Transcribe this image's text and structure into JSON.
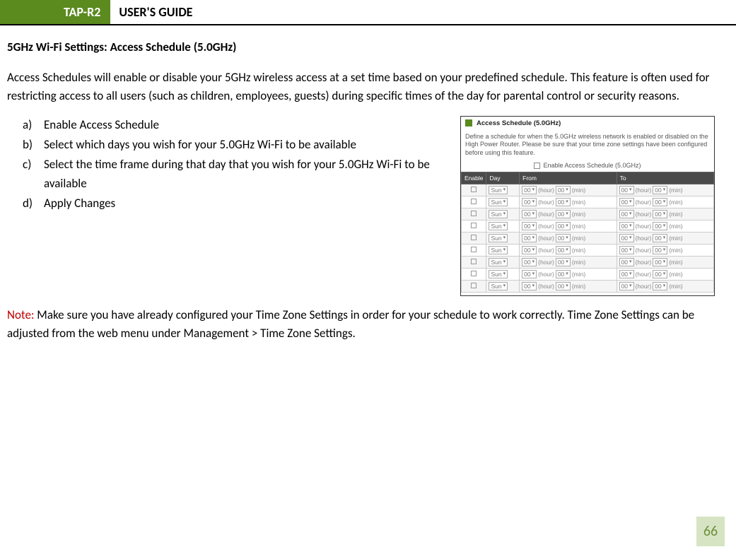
{
  "header": {
    "model": "TAP-R2",
    "title": "USER'S GUIDE"
  },
  "section_title": "5GHz Wi-Fi Settings: Access Schedule (5.0GHz)",
  "intro": "Access Schedules will enable or disable your 5GHz wireless access at a set time based on your predefined schedule. This feature is often used for restricting access to all users (such as children, employees, guests) during specific times of the day for parental control or security reasons.",
  "steps": [
    {
      "marker": "a)",
      "text": "Enable Access Schedule"
    },
    {
      "marker": "b)",
      "text": "Select which days you wish for your 5.0GHz Wi-Fi to be available"
    },
    {
      "marker": "c)",
      "text": "Select the time frame during that day that you wish for your 5.0GHz Wi-Fi to be available"
    },
    {
      "marker": "d)",
      "text": "Apply Changes"
    }
  ],
  "screenshot": {
    "title": "Access Schedule (5.0GHz)",
    "desc": "Define a schedule for when the 5.0GHz wireless network is enabled or disabled on the High Power Router. Please be sure that your time zone settings have been configured before using this feature.",
    "enable_label": "Enable Access Schedule (5.0GHz)",
    "cols": {
      "enable": "Enable",
      "day": "Day",
      "from": "From",
      "to": "To"
    },
    "row": {
      "day": "Sun",
      "hh": "00",
      "mm": "00",
      "hour_lbl": "(hour)",
      "min_lbl": "(min)"
    },
    "row_count": 9
  },
  "note": {
    "label": "Note:",
    "text": "  Make sure you have already configured your Time Zone Settings in order for your schedule to work correctly. Time Zone Settings can be adjusted from the web menu under Management > Time Zone Settings."
  },
  "page_number": "66"
}
